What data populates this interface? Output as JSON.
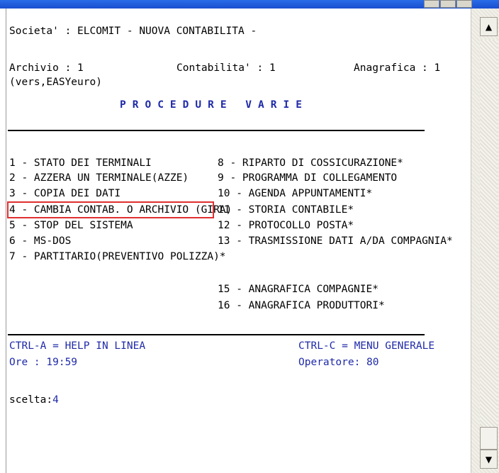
{
  "header": {
    "societa": "Societa' : ELCOMIT - NUOVA CONTABILITA -",
    "archivio": "Archivio : 1",
    "contabilita": "Contabilita' : 1",
    "anagrafica": "Anagrafica : 1",
    "version": "(vers,EASYeuro)",
    "title": "PROCEDURE VARIE"
  },
  "menu": {
    "left": [
      "1 - STATO DEI TERMINALI",
      "2 - AZZERA UN TERMINALE(AZZE)",
      "3 - COPIA DEI DATI",
      "4 - CAMBIA CONTAB. O ARCHIVIO (GIRA)",
      "5 - STOP DEL SISTEMA",
      "6 - MS-DOS",
      "7 - PARTITARIO(PREVENTIVO POLIZZA)*"
    ],
    "right": [
      "8 - RIPARTO DI COSSICURAZIONE*",
      "9 - PROGRAMMA DI COLLEGAMENTO",
      "10 - AGENDA APPUNTAMENTI*",
      "11 - STORIA CONTABILE*",
      "12 - PROTOCOLLO POSTA*",
      "13 - TRASMISSIONE DATI A/DA COMPAGNIA*",
      "15 - ANAGRAFICA COMPAGNIE*",
      "16 - ANAGRAFICA PRODUTTORI*"
    ],
    "selected_index": 3
  },
  "footer": {
    "help": "CTRL-A = HELP IN LINEA",
    "menu_generale": "CTRL-C = MENU GENERALE",
    "ore_label": "Ore : 19:59",
    "operatore_label": "Operatore: 80"
  },
  "prompt": {
    "label": "scelta:",
    "value": "4"
  },
  "colors": {
    "text": "#000000",
    "accent": "#1f2aa8",
    "highlight": "#e03030",
    "titlebar": "#1a4fcf"
  },
  "icons": {
    "scroll_up": "triangle-up-icon",
    "scroll_down": "triangle-down-icon"
  }
}
